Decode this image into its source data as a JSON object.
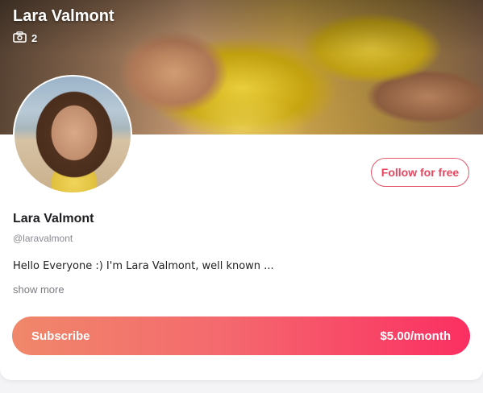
{
  "cover": {
    "title": "Lara Valmont",
    "stats_count": "2"
  },
  "profile": {
    "name": "Lara Valmont",
    "handle": "@laravalmont",
    "bio": "Hello Everyone :) I'm Lara Valmont, well known ...",
    "show_more": "show more"
  },
  "actions": {
    "follow_label": "Follow for free",
    "subscribe_label": "Subscribe",
    "subscribe_price": "$5.00/month"
  },
  "colors": {
    "accent": "#e8455e",
    "subscribe_gradient_start": "#f0876a",
    "subscribe_gradient_end": "#fb2f62"
  },
  "icons": {
    "stats": "camera-icon"
  }
}
